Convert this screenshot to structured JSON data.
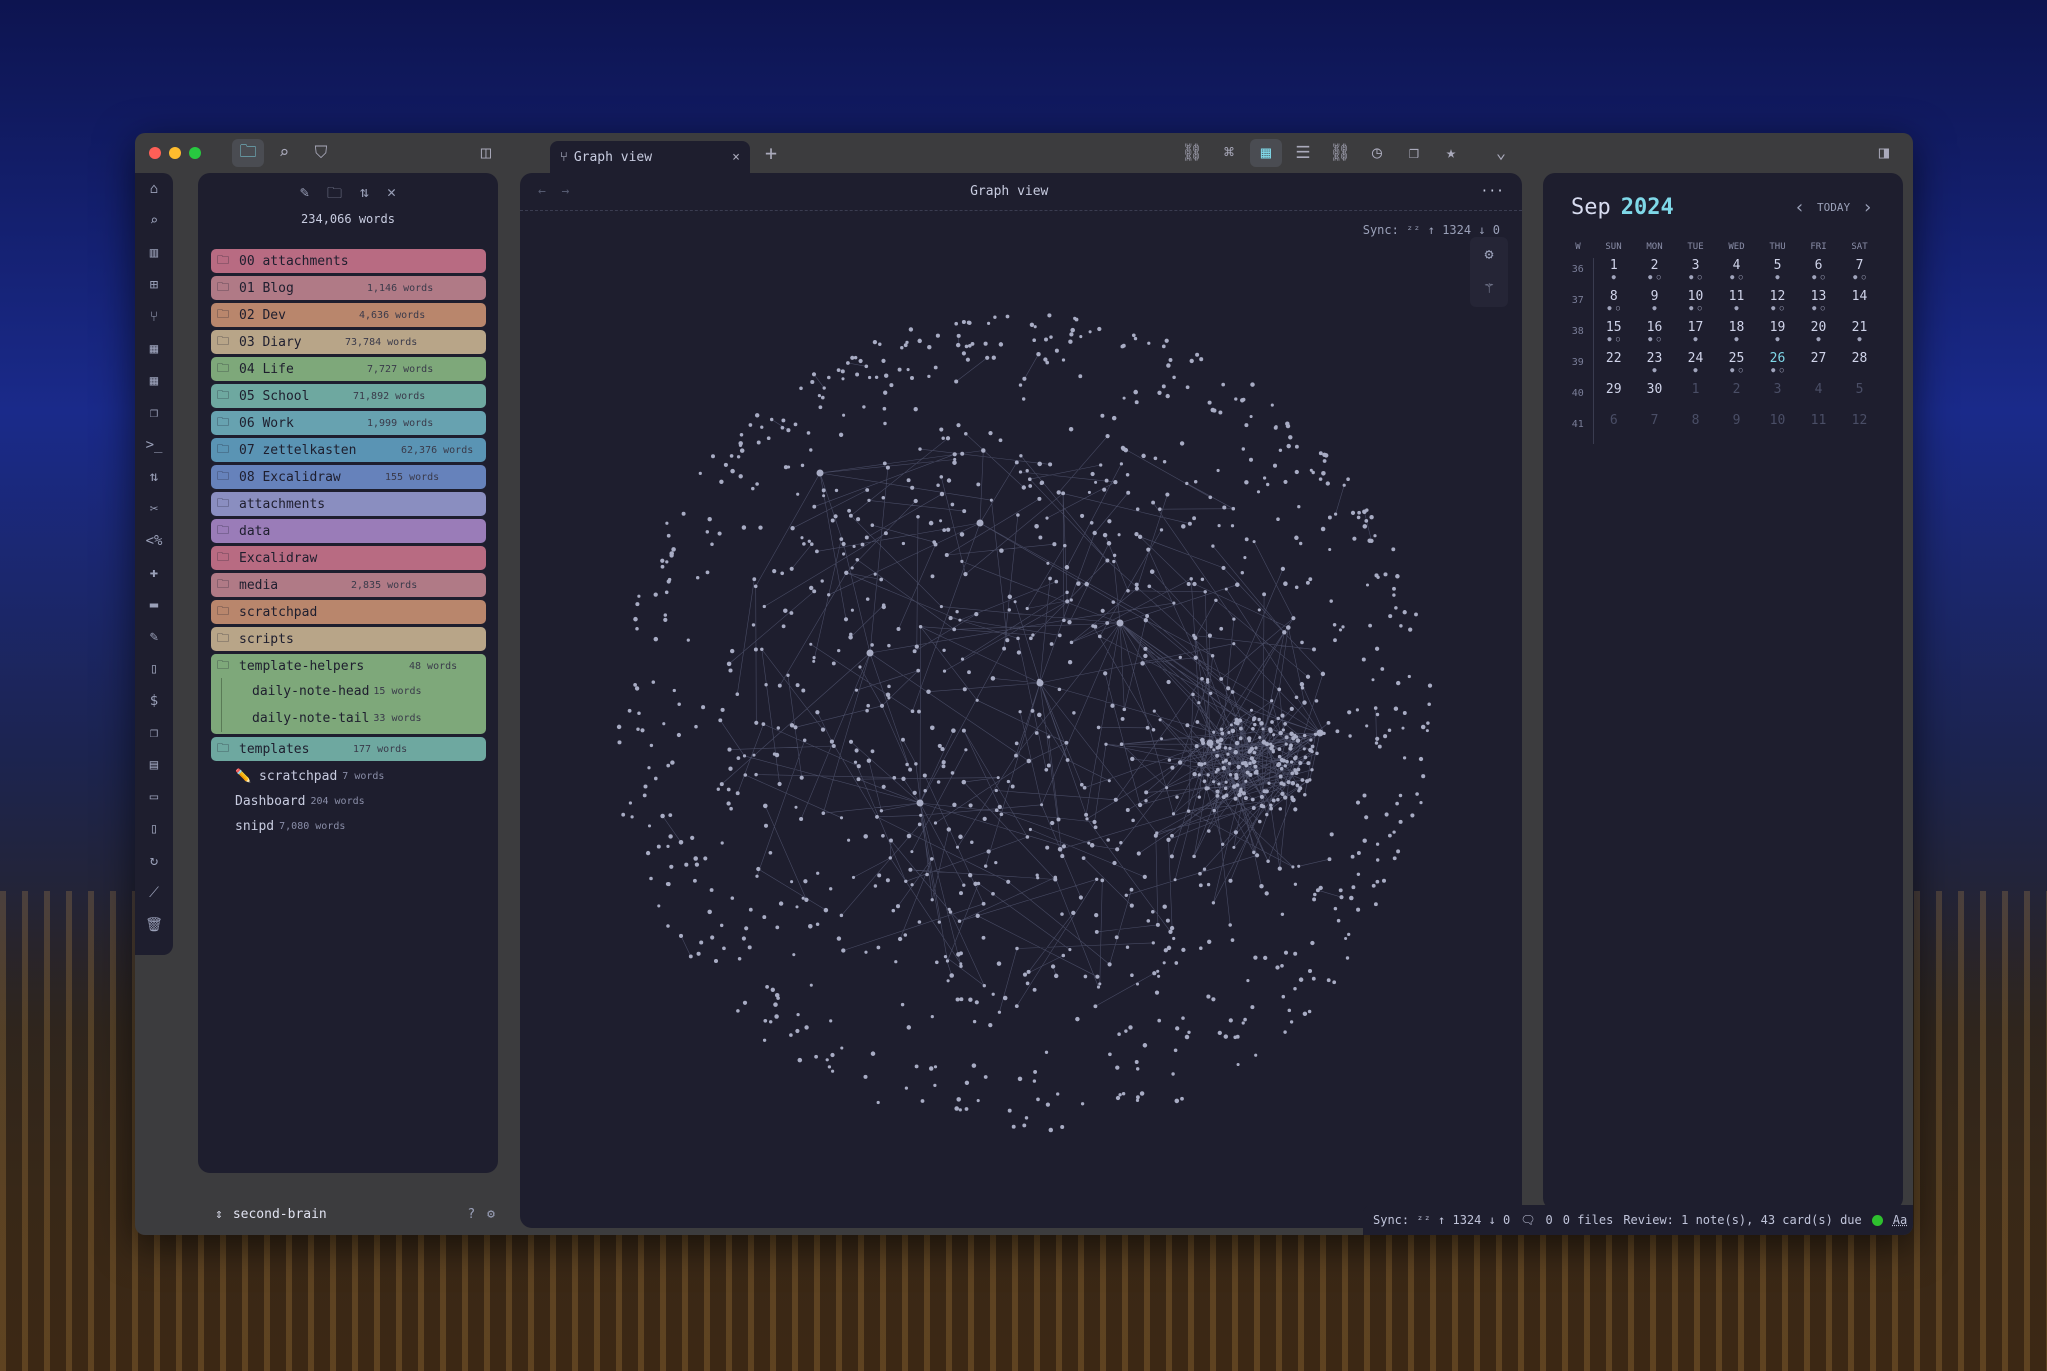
{
  "titlebar": {
    "tab_title": "Graph view",
    "tab_icon": "graph-icon",
    "new_tab": "+",
    "close": "×",
    "left_icons": [
      "folder-icon",
      "search-icon",
      "bookmark-icon"
    ],
    "right_icons": [
      "outgoing-links-icon",
      "tags-icon",
      "calendar-icon",
      "outline-icon",
      "backlinks-icon",
      "recent-files-icon",
      "copy-icon",
      "flashcards-icon"
    ]
  },
  "ribbon": {
    "icons": [
      "home-icon",
      "search-icon",
      "book-icon",
      "file-plus-icon",
      "graph-icon",
      "grid-icon",
      "calendar-icon",
      "copy-icon",
      "terminal-icon",
      "sort-icon",
      "tools-icon",
      "code-icon",
      "puzzle-icon",
      "archive-icon",
      "brush-icon",
      "file-icon",
      "dollar-icon",
      "pages-icon",
      "list-icon",
      "slides-icon",
      "tablet-icon",
      "refresh-icon",
      "chart-icon",
      "trash-icon"
    ]
  },
  "sidebar": {
    "total_words": "234,066 words",
    "folders": [
      {
        "name": "00 attachments",
        "words": "",
        "color": "#b86b82"
      },
      {
        "name": "01 Blog",
        "words": "1,146 words",
        "color": "#b07a86"
      },
      {
        "name": "02 Dev",
        "words": "4,636 words",
        "color": "#b9866c"
      },
      {
        "name": "03 Diary",
        "words": "73,784 words",
        "color": "#b8a588"
      },
      {
        "name": "04 Life",
        "words": "7,727 words",
        "color": "#7ea87a"
      },
      {
        "name": "05 School",
        "words": "71,892 words",
        "color": "#6ea8a0"
      },
      {
        "name": "06 Work",
        "words": "1,999 words",
        "color": "#67a2b0"
      },
      {
        "name": "07 zettelkasten",
        "words": "62,376 words",
        "color": "#5a94b4"
      },
      {
        "name": "08 Excalidraw",
        "words": "155 words",
        "color": "#6682bb"
      },
      {
        "name": "attachments",
        "words": "",
        "color": "#8a8ec0"
      },
      {
        "name": "data",
        "words": "",
        "color": "#9a7cb8"
      },
      {
        "name": "Excalidraw",
        "words": "",
        "color": "#b86b82"
      },
      {
        "name": "media",
        "words": "2,835 words",
        "color": "#b07a86"
      },
      {
        "name": "scratchpad",
        "words": "",
        "color": "#b9866c"
      },
      {
        "name": "scripts",
        "words": "",
        "color": "#b8a588"
      }
    ],
    "template_helpers": {
      "name": "template-helpers",
      "words": "48 words",
      "color": "#7ea87a",
      "children": [
        {
          "name": "daily-note-head",
          "words": "15 words"
        },
        {
          "name": "daily-note-tail",
          "words": "33 words"
        }
      ]
    },
    "templates": {
      "name": "templates",
      "words": "177 words",
      "color": "#6ea8a0"
    },
    "files": [
      {
        "name": "✏️ scratchpad",
        "words": "7 words"
      },
      {
        "name": "Dashboard",
        "words": "204 words"
      },
      {
        "name": "snipd",
        "words": "7,080 words"
      }
    ],
    "vault_name": "second-brain"
  },
  "main": {
    "title": "Graph view",
    "sync": "Sync: ᶻᶻ ↑ 1324 ↓ 0",
    "more": "···"
  },
  "calendar": {
    "month": "Sep",
    "year": "2024",
    "today_label": "TODAY",
    "headers": [
      "W",
      "SUN",
      "MON",
      "TUE",
      "WED",
      "THU",
      "FRI",
      "SAT"
    ],
    "weeks": [
      {
        "w": "36",
        "days": [
          [
            "1",
            "•",
            ""
          ],
          [
            "2",
            "•o",
            ""
          ],
          [
            "3",
            "•o",
            ""
          ],
          [
            "4",
            "•o",
            ""
          ],
          [
            "5",
            "•",
            ""
          ],
          [
            "6",
            "•o",
            ""
          ],
          [
            "7",
            "•o",
            ""
          ]
        ]
      },
      {
        "w": "37",
        "days": [
          [
            "8",
            "•o",
            ""
          ],
          [
            "9",
            "•",
            ""
          ],
          [
            "10",
            "•o",
            ""
          ],
          [
            "11",
            "•",
            ""
          ],
          [
            "12",
            "•o",
            ""
          ],
          [
            "13",
            "•o",
            ""
          ],
          [
            "14",
            "",
            ""
          ]
        ]
      },
      {
        "w": "38",
        "days": [
          [
            "15",
            "•o",
            ""
          ],
          [
            "16",
            "•o",
            ""
          ],
          [
            "17",
            "•",
            ""
          ],
          [
            "18",
            "•",
            ""
          ],
          [
            "19",
            "•",
            ""
          ],
          [
            "20",
            "•",
            ""
          ],
          [
            "21",
            "•",
            ""
          ]
        ]
      },
      {
        "w": "39",
        "days": [
          [
            "22",
            "",
            ""
          ],
          [
            "23",
            "•",
            ""
          ],
          [
            "24",
            "•",
            ""
          ],
          [
            "25",
            "•o",
            ""
          ],
          [
            "26",
            "•o",
            "today"
          ],
          [
            "27",
            "",
            ""
          ],
          [
            "28",
            "",
            ""
          ]
        ]
      },
      {
        "w": "40",
        "days": [
          [
            "29",
            "",
            ""
          ],
          [
            "30",
            "",
            ""
          ],
          [
            "1",
            "",
            "dim"
          ],
          [
            "2",
            "",
            "dim"
          ],
          [
            "3",
            "",
            "dim"
          ],
          [
            "4",
            "",
            "dim"
          ],
          [
            "5",
            "",
            "dim"
          ]
        ]
      },
      {
        "w": "41",
        "days": [
          [
            "6",
            "",
            "dim"
          ],
          [
            "7",
            "",
            "dim"
          ],
          [
            "8",
            "",
            "dim"
          ],
          [
            "9",
            "",
            "dim"
          ],
          [
            "10",
            "",
            "dim"
          ],
          [
            "11",
            "",
            "dim"
          ],
          [
            "12",
            "",
            "dim"
          ]
        ]
      }
    ]
  },
  "status": {
    "sync": "Sync: ᶻᶻ ↑ 1324 ↓ 0",
    "comments": "0",
    "files": "0 files",
    "review": "Review: 1 note(s), 43 card(s) due",
    "font": "Aa"
  }
}
